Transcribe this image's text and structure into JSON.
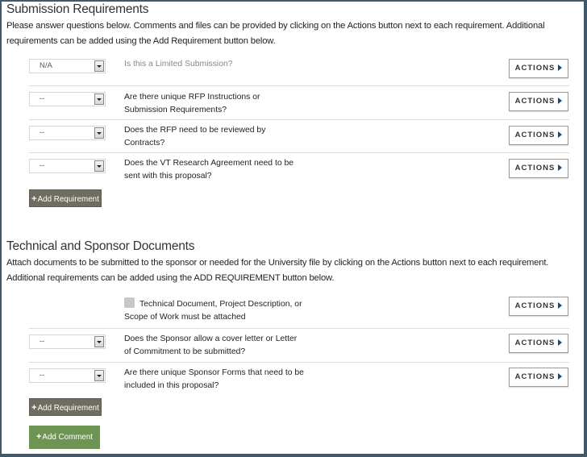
{
  "submission": {
    "title": "Submission Requirements",
    "description": "Please answer questions below. Comments and files can be provided by clicking on the Actions button next to each requirement. Additional requirements can be added using the Add Requirement button below.",
    "requirements": [
      {
        "select_value": "N/A",
        "question": "Is this a Limited Submission?",
        "actions_label": "ACTIONS"
      },
      {
        "select_value": "--",
        "question": "Are there unique RFP Instructions or Submission Requirements?",
        "actions_label": "ACTIONS"
      },
      {
        "select_value": "--",
        "question": "Does the RFP need to be reviewed by Contracts?",
        "actions_label": "ACTIONS"
      },
      {
        "select_value": "--",
        "question": "Does the VT Research Agreement need to be sent with this proposal?",
        "actions_label": "ACTIONS"
      }
    ],
    "add_requirement_label": "Add Requirement"
  },
  "technical": {
    "title": "Technical and Sponsor Documents",
    "description": "Attach documents to be submitted to the sponsor or needed for the University file by clicking on the Actions button next to each requirement. Additional requirements can be added using the ADD REQUIREMENT button below.",
    "requirements": [
      {
        "checkbox": true,
        "question": "Technical Document, Project Description, or Scope of Work must be attached",
        "actions_label": "ACTIONS"
      },
      {
        "select_value": "--",
        "question": "Does the Sponsor allow a cover letter or Letter of Commitment to be submitted?",
        "actions_label": "ACTIONS"
      },
      {
        "select_value": "--",
        "question": "Are there unique Sponsor Forms that need to be included in this proposal?",
        "actions_label": "ACTIONS"
      }
    ],
    "add_requirement_label": "Add Requirement",
    "add_comment_label": "Add Comment"
  },
  "icons": {
    "plus": "+",
    "actions_arrow": "caret-right"
  },
  "colors": {
    "frame_border": "#3d5a6c",
    "add_requirement_bg": "#6f6c61",
    "add_comment_bg": "#6e9454",
    "actions_arrow": "#234a6a"
  }
}
